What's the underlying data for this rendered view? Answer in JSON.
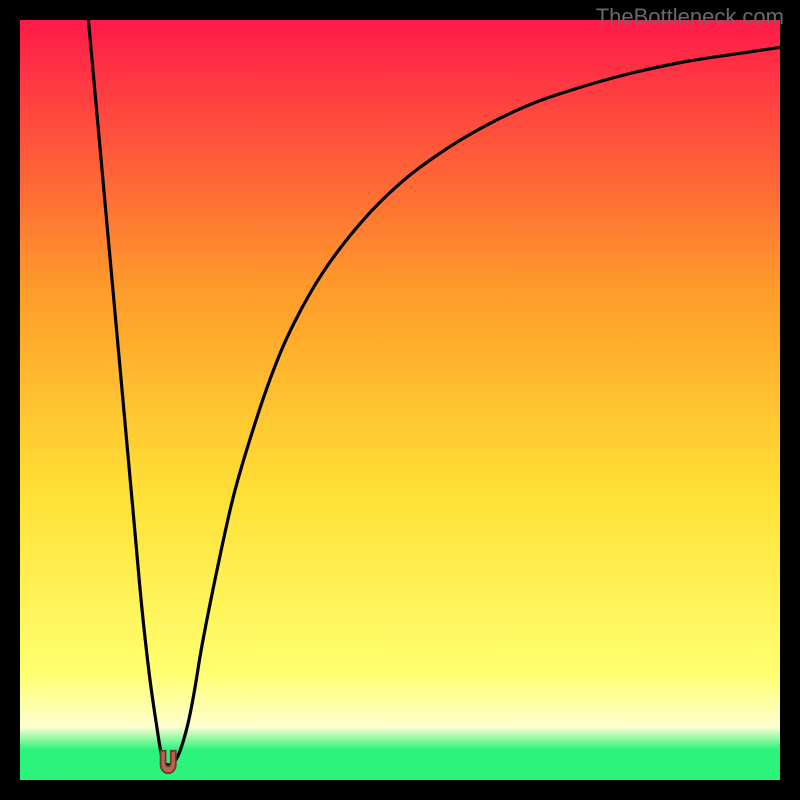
{
  "watermark": "TheBottleneck.com",
  "colors": {
    "frame": "#000000",
    "curve": "#000000",
    "marker_fill": "#bb6155",
    "gradient_top": "#ff1a4a",
    "gradient_mid_upper": "#ff9a2a",
    "gradient_mid": "#ffe035",
    "gradient_lower_yellow": "#ffff70",
    "gradient_pale": "#feffd0",
    "gradient_green": "#2cf47b"
  },
  "chart_data": {
    "type": "line",
    "title": "",
    "xlabel": "",
    "ylabel": "",
    "xlim": [
      0,
      100
    ],
    "ylim": [
      0,
      100
    ],
    "grid": false,
    "legend": false,
    "note": "Axis values estimated from plot area proportions; no tick labels shown.",
    "series": [
      {
        "name": "curve",
        "x": [
          9,
          10,
          11,
          12,
          13,
          14,
          15,
          16,
          17,
          18,
          18.7,
          19.5,
          20.7,
          22,
          23,
          24,
          26,
          28,
          30,
          33,
          36,
          40,
          45,
          50,
          55,
          60,
          66,
          72,
          80,
          88,
          96,
          100
        ],
        "y": [
          100,
          89,
          78,
          67,
          56,
          45,
          34,
          23,
          14,
          7,
          3,
          2,
          3,
          7,
          12,
          18,
          28,
          37,
          44,
          53,
          60,
          67,
          73.5,
          78.5,
          82.3,
          85.4,
          88.4,
          90.6,
          92.9,
          94.6,
          95.8,
          96.4
        ]
      }
    ],
    "marker": {
      "x_range": [
        18.5,
        20.5
      ],
      "y": 2,
      "shape": "U",
      "meaning": "minimum / optimal point"
    },
    "background_gradient_bands": [
      {
        "from_y": 100,
        "to_y": 35,
        "style": "smooth red→orange→yellow"
      },
      {
        "from_y": 35,
        "to_y": 14,
        "style": "yellow"
      },
      {
        "from_y": 14,
        "to_y": 5,
        "style": "pale yellow"
      },
      {
        "from_y": 5,
        "to_y": 0,
        "style": "green"
      }
    ]
  }
}
